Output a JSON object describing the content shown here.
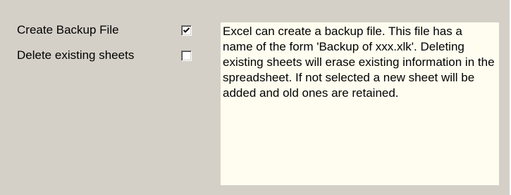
{
  "options": {
    "backup": {
      "label": "Create Backup File",
      "checked": true
    },
    "delete_sheets": {
      "label": "Delete existing sheets",
      "checked": false
    }
  },
  "description": {
    "text": "Excel can create a backup file. This file has a name of the form 'Backup of xxx.xlk'. Deleting existing sheets will erase existing information in the spreadsheet. If not selected a new sheet will be added and old ones are retained."
  },
  "colors": {
    "panel_background": "#d4d0c8",
    "description_background": "#fffdef"
  }
}
